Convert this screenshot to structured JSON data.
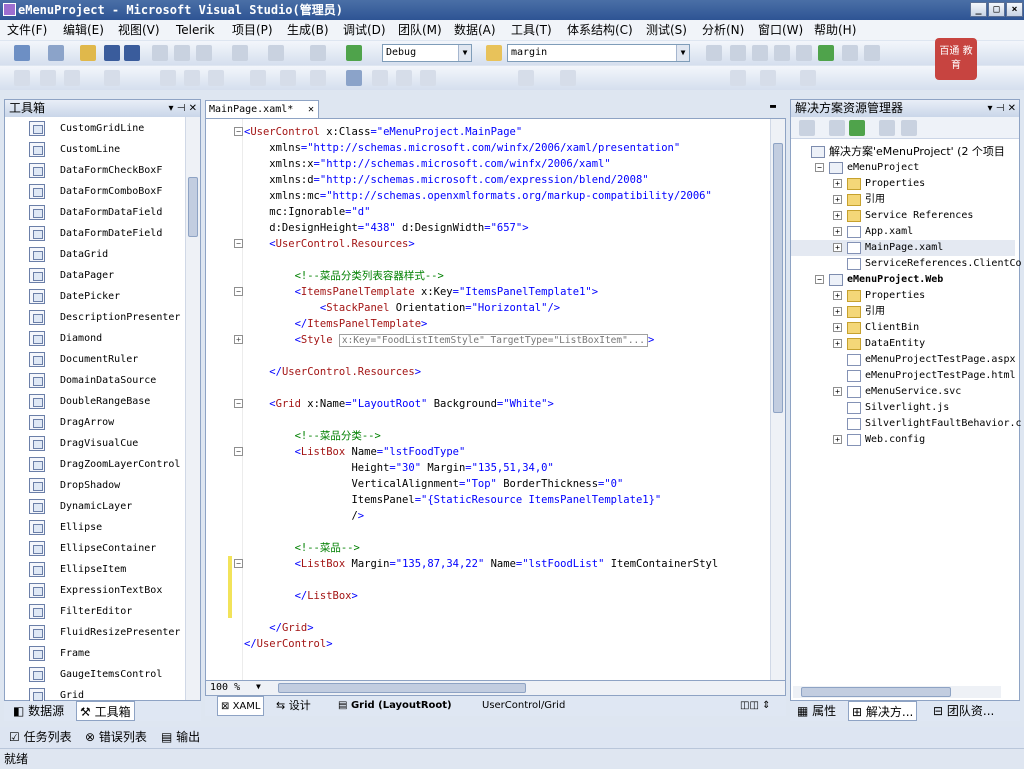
{
  "titlebar": {
    "title": "eMenuProject - Microsoft Visual Studio(管理员)",
    "btn_min": "_",
    "btn_max": "□",
    "btn_close": "×"
  },
  "menu": [
    "文件(F)",
    "编辑(E)",
    "视图(V)",
    "Telerik",
    "项目(P)",
    "生成(B)",
    "调试(D)",
    "团队(M)",
    "数据(A)",
    "工具(T)",
    "体系结构(C)",
    "测试(S)",
    "分析(N)",
    "窗口(W)",
    "帮助(H)"
  ],
  "toolbar": {
    "config_value": "Debug",
    "find_value": "margin"
  },
  "toolbox": {
    "title": "工具箱",
    "items": [
      "CustomGridLine",
      "CustomLine",
      "DataFormCheckBoxF",
      "DataFormComboBoxF",
      "DataFormDataField",
      "DataFormDateField",
      "DataGrid",
      "DataPager",
      "DatePicker",
      "DescriptionPresenter",
      "Diamond",
      "DocumentRuler",
      "DomainDataSource",
      "DoubleRangeBase",
      "DragArrow",
      "DragVisualCue",
      "DragZoomLayerControl",
      "DropShadow",
      "DynamicLayer",
      "Ellipse",
      "EllipseContainer",
      "EllipseItem",
      "ExpressionTextBox",
      "FilterEditor",
      "FluidResizePresenter",
      "Frame",
      "GaugeItemsControl",
      "Grid"
    ],
    "tab_datasource": "数据源",
    "tab_toolbox": "工具箱"
  },
  "editor": {
    "tab_label": "MainPage.xaml*",
    "zoom": "100 %",
    "bottom_tab_xaml": "XAML",
    "bottom_tab_design": "设计",
    "breadcrumb_grid": "Grid (LayoutRoot)",
    "breadcrumb_path": "UserControl/Grid",
    "lines": [
      "<UserControl x:Class=\"eMenuProject.MainPage\"",
      "    xmlns=\"http://schemas.microsoft.com/winfx/2006/xaml/presentation\"",
      "    xmlns:x=\"http://schemas.microsoft.com/winfx/2006/xaml\"",
      "    xmlns:d=\"http://schemas.microsoft.com/expression/blend/2008\"",
      "    xmlns:mc=\"http://schemas.openxmlformats.org/markup-compatibility/2006\"",
      "    mc:Ignorable=\"d\"",
      "    d:DesignHeight=\"438\" d:DesignWidth=\"657\">",
      "    <UserControl.Resources>",
      "",
      "        <!--菜品分类列表容器样式-->",
      "        <ItemsPanelTemplate x:Key=\"ItemsPanelTemplate1\">",
      "            <StackPanel Orientation=\"Horizontal\"/>",
      "        </ItemsPanelTemplate>",
      "        <Style x:Key=\"FoodListItemStyle\" TargetType=\"ListBoxItem\"...>",
      "",
      "    </UserControl.Resources>",
      "",
      "    <Grid x:Name=\"LayoutRoot\" Background=\"White\">",
      "",
      "        <!--菜品分类-->",
      "        <ListBox Name=\"lstFoodType\"",
      "                 Height=\"30\" Margin=\"135,51,34,0\"",
      "                 VerticalAlignment=\"Top\" BorderThickness=\"0\"",
      "                 ItemsPanel=\"{StaticResource ItemsPanelTemplate1}\"",
      "                 />",
      "",
      "        <!--菜品-->",
      "        <ListBox Margin=\"135,87,34,22\" Name=\"lstFoodList\" ItemContainerStyl",
      "",
      "        </ListBox>",
      "",
      "    </Grid>",
      "</UserControl>"
    ]
  },
  "solution": {
    "title": "解决方案资源管理器",
    "items": [
      {
        "label": "解决方案'eMenuProject' (2 个项目",
        "bold": false
      },
      {
        "label": "eMenuProject",
        "bold": false
      },
      {
        "label": "Properties",
        "bold": false
      },
      {
        "label": "引用",
        "bold": false
      },
      {
        "label": "Service References",
        "bold": false
      },
      {
        "label": "App.xaml",
        "bold": false
      },
      {
        "label": "MainPage.xaml",
        "bold": false
      },
      {
        "label": "ServiceReferences.ClientCo",
        "bold": false
      },
      {
        "label": "eMenuProject.Web",
        "bold": true
      },
      {
        "label": "Properties",
        "bold": false
      },
      {
        "label": "引用",
        "bold": false
      },
      {
        "label": "ClientBin",
        "bold": false
      },
      {
        "label": "DataEntity",
        "bold": false
      },
      {
        "label": "eMenuProjectTestPage.aspx",
        "bold": false
      },
      {
        "label": "eMenuProjectTestPage.html",
        "bold": false
      },
      {
        "label": "eMenuService.svc",
        "bold": false
      },
      {
        "label": "Silverlight.js",
        "bold": false
      },
      {
        "label": "SilverlightFaultBehavior.c",
        "bold": false
      },
      {
        "label": "Web.config",
        "bold": false
      }
    ],
    "tab_properties": "属性",
    "tab_solution": "解决方...",
    "tab_team": "团队资..."
  },
  "bottom_tabs": {
    "tasks": "任务列表",
    "errors": "错误列表",
    "output": "输出"
  },
  "status": {
    "text": "就绪"
  },
  "logo": {
    "text": "百通 教育"
  }
}
